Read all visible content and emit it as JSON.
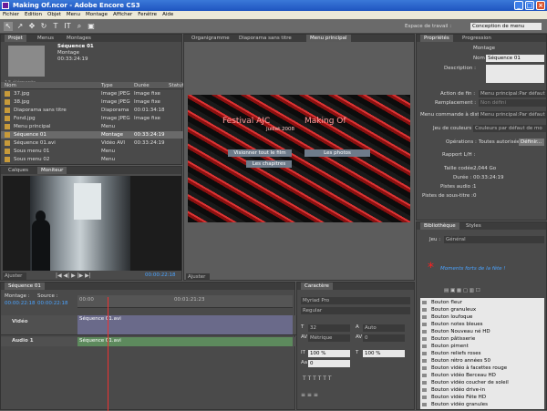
{
  "window": {
    "title": "Making Of.ncor - Adobe Encore CS3"
  },
  "menu": [
    "Fichier",
    "Edition",
    "Objet",
    "Menu",
    "Montage",
    "Afficher",
    "Fenêtre",
    "Aide"
  ],
  "workspace": {
    "label": "Espace de travail :",
    "value": "Conception de menu"
  },
  "project": {
    "tabs": [
      "Projet",
      "Menus",
      "Montages"
    ],
    "preview_name": "Séquence 01",
    "preview_type": "Montage",
    "preview_dur": "00:33:24:19",
    "count": "13 éléments",
    "headers": [
      "Nom",
      "Type",
      "Durée",
      "Statut"
    ],
    "rows": [
      {
        "name": "37.jpg",
        "type": "Image JPEG",
        "dur": "Image fixe"
      },
      {
        "name": "38.jpg",
        "type": "Image JPEG",
        "dur": "Image fixe"
      },
      {
        "name": "Diaporama sans titre",
        "type": "Diaporama",
        "dur": "00:01:34:18"
      },
      {
        "name": "Fond.jpg",
        "type": "Image JPEG",
        "dur": "Image fixe"
      },
      {
        "name": "Menu principal",
        "type": "Menu",
        "dur": ""
      },
      {
        "name": "Séquence 01",
        "type": "Montage",
        "dur": "00:33:24:19"
      },
      {
        "name": "Séquence 01.avi",
        "type": "Vidéo AVI",
        "dur": "00:33:24:19"
      },
      {
        "name": "Sous menu 01",
        "type": "Menu",
        "dur": ""
      },
      {
        "name": "Sous menu 02",
        "type": "Menu",
        "dur": ""
      }
    ]
  },
  "monitor": {
    "tabs": [
      "Calques",
      "Moniteur"
    ],
    "fit": "Ajuster",
    "timecode": "00:00:22:18"
  },
  "center": {
    "tabs": [
      "Organigramme",
      "Diaporama sans titre",
      "Menu principal"
    ],
    "fit": "Ajuster",
    "menu": {
      "title1": "Festival AJC",
      "title2": "Making Of",
      "date": "Juillet 2008",
      "btn1": "Visionner tout le film",
      "btn2": "Les photos",
      "btn3": "Les chapitres"
    }
  },
  "props": {
    "tabs": [
      "Propriétés",
      "Progression"
    ],
    "heading": "Montage",
    "nom_label": "Nom :",
    "nom": "Séquence 01",
    "desc_label": "Description :",
    "fin_label": "Action de fin :",
    "fin": "Menu principal:Par défaut",
    "remp_label": "Remplacement :",
    "remp": "Non défini",
    "cmd_label": "Menu commande à dist. :",
    "cmd": "Menu principal:Par défaut",
    "jeu_label": "Jeu de couleurs :",
    "jeu": "Couleurs par défaut de mo",
    "ops_label": "Opérations :",
    "ops": "Toutes autorisées",
    "ops_btn": "Définir...",
    "ratio_label": "Rapport L/H :",
    "taille_label": "Taille codée :",
    "taille": "2,044 Go",
    "duree_label": "Durée :",
    "duree": "00:33:24:19",
    "pistes_v_label": "Pistes audio :",
    "pistes_v": "1",
    "pistes_s_label": "Pistes de sous-titre :",
    "pistes_s": "0"
  },
  "timeline": {
    "tab": "Séquence 01",
    "montage_label": "Montage :",
    "montage_tc": "00:00:22:18",
    "source_label": "Source :",
    "source_tc": "00:00:22:18",
    "ruler1": "00:00",
    "ruler2": "00:01:21:23",
    "video_track": "Vidéo",
    "audio_track": "Audio 1",
    "video_clip": "Séquence 01.avi",
    "audio_clip": "Séquence 01.avi"
  },
  "character": {
    "tab": "Caractère",
    "font": "Myriad Pro",
    "style": "Regular",
    "size": "32",
    "leading": "Auto",
    "tracking_mode": "Métrique",
    "tracking": "0",
    "hscale": "100 %",
    "vscale": "100 %",
    "baseline": "0"
  },
  "library": {
    "tabs": [
      "Bibliothèque",
      "Styles"
    ],
    "set_label": "Jeu :",
    "set": "Général",
    "preview_text": "Moments forts de la fête !",
    "items": [
      "Bouton fleur",
      "Bouton granuleux",
      "Bouton loufoque",
      "Bouton notes bleues",
      "Bouton Nouveau né HD",
      "Bouton pâtisserie",
      "Bouton piment",
      "Bouton reliefs roses",
      "Bouton rétro années 50",
      "Bouton vidéo à facettes rouge",
      "Bouton vidéo Berceau HD",
      "Bouton vidéo coucher de soleil",
      "Bouton vidéo drive-in",
      "Bouton vidéo Fête HD",
      "Bouton vidéo granules"
    ]
  },
  "colors": {
    "accent": "#4aa3ff",
    "star": "#ff2020"
  }
}
